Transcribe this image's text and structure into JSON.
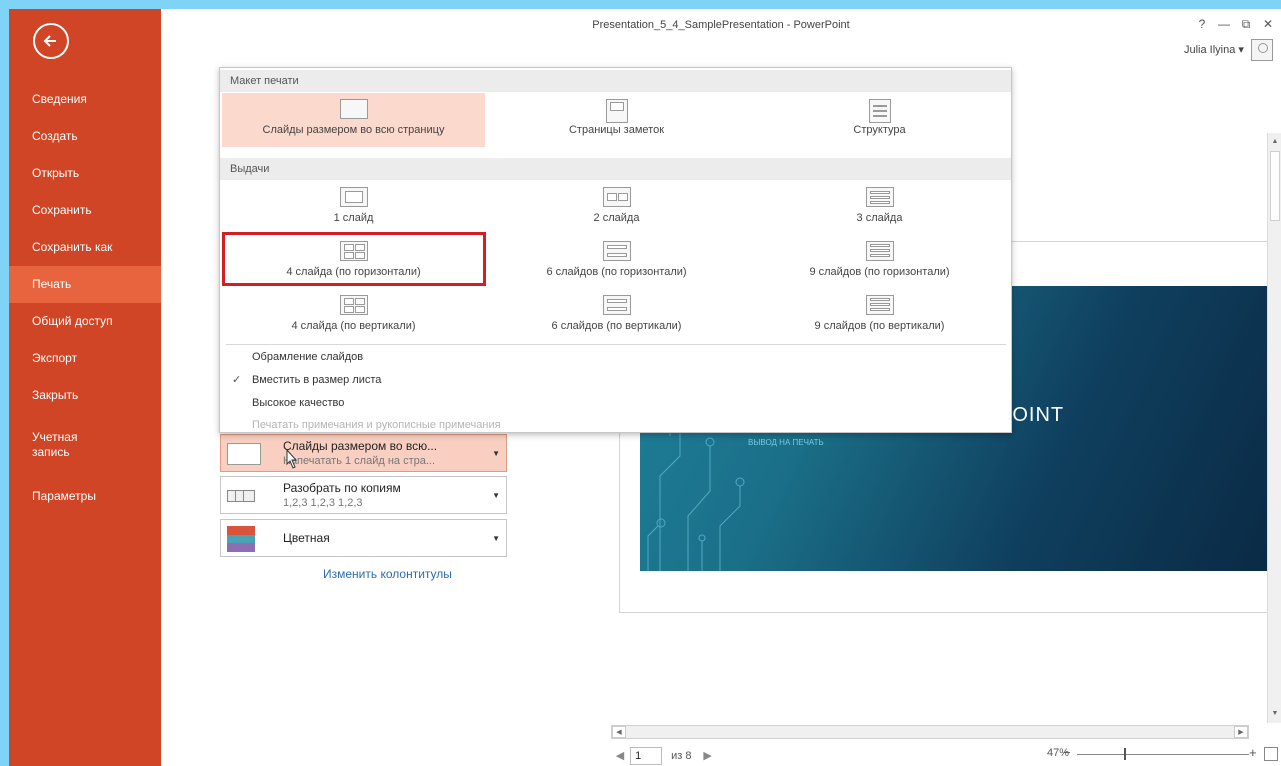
{
  "window": {
    "title": "Presentation_5_4_SamplePresentation - PowerPoint",
    "controls": [
      "?",
      "—",
      "⧉",
      "✕"
    ],
    "user": "Julia Ilyina"
  },
  "sidebar": {
    "items": [
      {
        "label": "Сведения"
      },
      {
        "label": "Создать"
      },
      {
        "label": "Открыть"
      },
      {
        "label": "Сохранить"
      },
      {
        "label": "Сохранить как"
      },
      {
        "label": "Печать",
        "active": true
      },
      {
        "label": "Общий доступ"
      },
      {
        "label": "Экспорт"
      },
      {
        "label": "Закрыть"
      }
    ],
    "account_line1": "Учетная",
    "account_line2": "запись",
    "options": "Параметры"
  },
  "print_layout_menu": {
    "section_layout": "Макет печати",
    "layout_options": [
      {
        "label": "Слайды размером во всю страницу",
        "selected": true
      },
      {
        "label": "Страницы заметок"
      },
      {
        "label": "Структура"
      }
    ],
    "section_handouts": "Выдачи",
    "handout_options": [
      {
        "label": "1 слайд"
      },
      {
        "label": "2 слайда"
      },
      {
        "label": "3 слайда"
      },
      {
        "label": "4 слайда (по горизонтали)",
        "highlighted": true
      },
      {
        "label": "6 слайдов (по горизонтали)"
      },
      {
        "label": "9 слайдов (по горизонтали)"
      },
      {
        "label": "4 слайда (по вертикали)"
      },
      {
        "label": "6 слайдов (по вертикали)"
      },
      {
        "label": "9 слайдов (по вертикали)"
      }
    ],
    "toggles": [
      {
        "label": "Обрамление слайдов",
        "checked": false,
        "disabled": false
      },
      {
        "label": "Вместить в размер листа",
        "checked": true,
        "disabled": false
      },
      {
        "label": "Высокое качество",
        "checked": false,
        "disabled": false
      },
      {
        "label": "Печатать примечания и рукописные примечания",
        "checked": false,
        "disabled": true
      }
    ]
  },
  "settings": {
    "layout_button": {
      "line1": "Слайды размером во всю...",
      "line2": "Напечатать 1 слайд на стра..."
    },
    "collate_button": {
      "line1": "Разобрать по копиям",
      "line2": "1,2,3   1,2,3   1,2,3"
    },
    "color_button": {
      "line1": "Цветная"
    },
    "edit_header_footer": "Изменить колонтитулы"
  },
  "preview": {
    "slide_title": "POINT",
    "slide_subtitle": "ВЫВОД НА ПЕЧАТЬ",
    "page_current": "1",
    "page_of": "из 8",
    "zoom": "47%"
  },
  "colors": {
    "sidebar": "#d04525",
    "sidebar_active": "#e8643f",
    "selected_option": "#fbd9cc",
    "annotation_box": "#d11f26",
    "swatch": [
      "#d9533d",
      "#4aa3b5",
      "#8e6db3"
    ]
  },
  "icons": [
    "back-arrow-icon",
    "user-avatar-icon",
    "cursor-icon",
    "fit-to-window-icon"
  ]
}
